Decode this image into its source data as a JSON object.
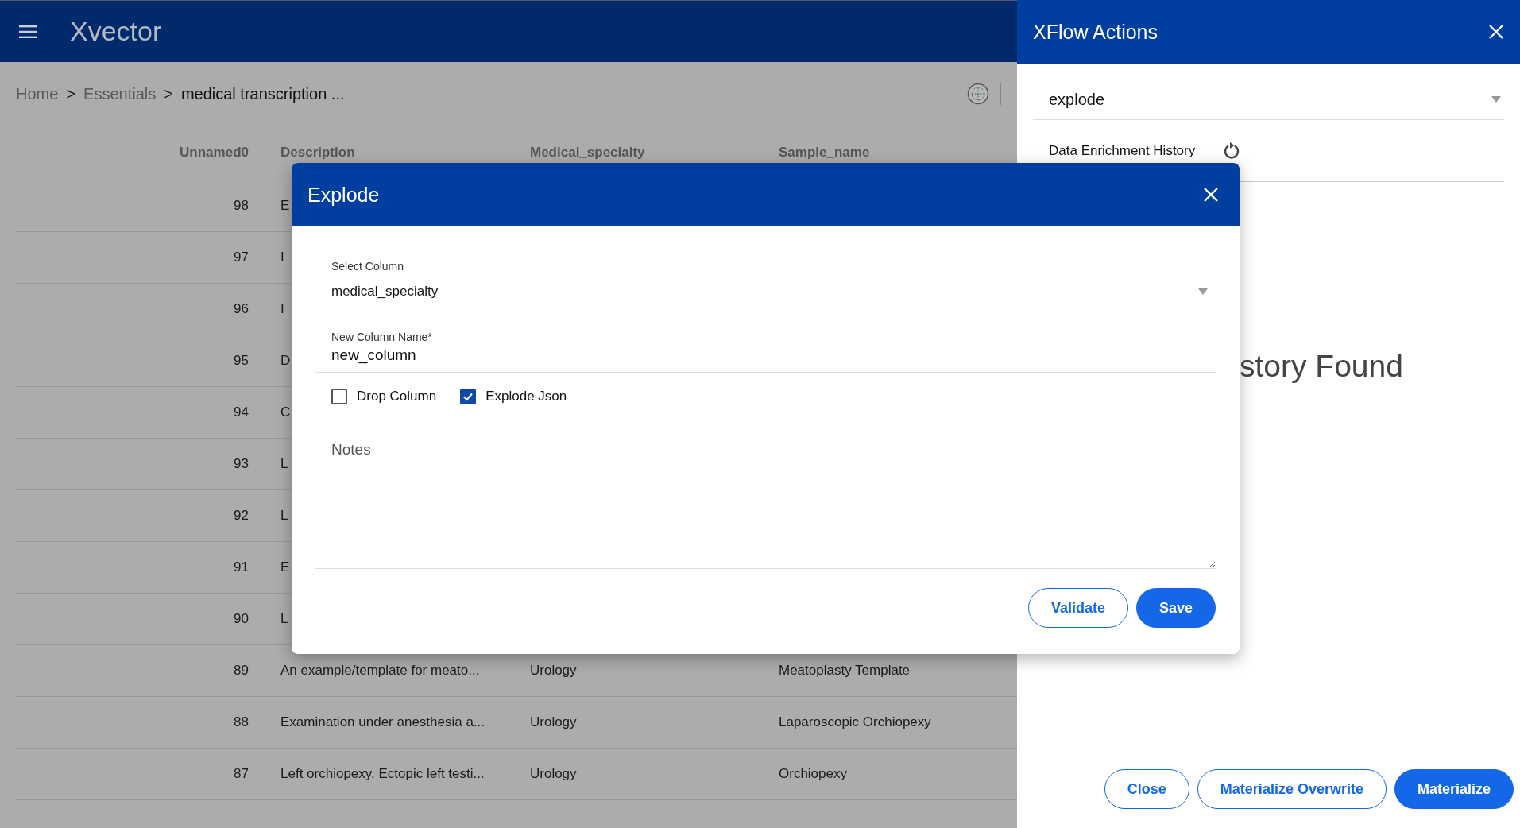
{
  "app": {
    "logo": "Xvector"
  },
  "breadcrumb": [
    {
      "label": "Home",
      "current": false
    },
    {
      "label": "Essentials",
      "current": false
    },
    {
      "label": "medical transcription ...",
      "current": true
    }
  ],
  "breadcrumb_separator": ">",
  "table": {
    "columns": [
      "Unnamed0",
      "Description",
      "Medical_specialty",
      "Sample_name"
    ],
    "rows": [
      {
        "cells": [
          "98",
          "E",
          "",
          ""
        ]
      },
      {
        "cells": [
          "97",
          "I",
          "",
          ""
        ]
      },
      {
        "cells": [
          "96",
          "I",
          "",
          ""
        ]
      },
      {
        "cells": [
          "95",
          "D",
          "",
          ""
        ]
      },
      {
        "cells": [
          "94",
          "C",
          "",
          ""
        ]
      },
      {
        "cells": [
          "93",
          "L",
          "",
          ""
        ]
      },
      {
        "cells": [
          "92",
          "L",
          "",
          ""
        ]
      },
      {
        "cells": [
          "91",
          "E",
          "",
          ""
        ]
      },
      {
        "cells": [
          "90",
          "L",
          "",
          ""
        ]
      },
      {
        "cells": [
          "89",
          "An example/template for meato...",
          "Urology",
          "Meatoplasty Template"
        ]
      },
      {
        "cells": [
          "88",
          "Examination under anesthesia a...",
          "Urology",
          "Laparoscopic Orchiopexy"
        ]
      },
      {
        "cells": [
          "87",
          "Left orchiopexy. Ectopic left testi...",
          "Urology",
          "Orchiopexy"
        ]
      }
    ]
  },
  "xflow_panel": {
    "title": "XFlow Actions",
    "action_select": {
      "value": "explode"
    },
    "history_label": "Data Enrichment History",
    "empty_message": "story Found",
    "buttons": [
      {
        "label": "Close",
        "kind": "outline"
      },
      {
        "label": "Materialize Overwrite",
        "kind": "outline"
      },
      {
        "label": "Materialize",
        "kind": "primary"
      }
    ]
  },
  "dialog": {
    "title": "Explode",
    "select_column": {
      "label": "Select Column",
      "value": "medical_specialty"
    },
    "new_column_name": {
      "label": "New Column Name*",
      "value": "new_column"
    },
    "checkboxes": [
      {
        "label": "Drop Column",
        "checked": false
      },
      {
        "label": "Explode Json",
        "checked": true
      }
    ],
    "notes": {
      "placeholder": "Notes"
    },
    "buttons": [
      {
        "label": "Validate",
        "kind": "outline"
      },
      {
        "label": "Save",
        "kind": "primary"
      }
    ]
  }
}
